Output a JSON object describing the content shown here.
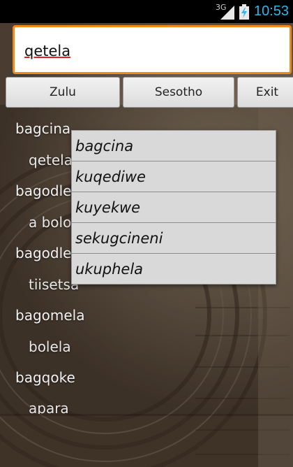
{
  "status_bar": {
    "network": "3G",
    "time": "10:53",
    "accent_color": "#33b5e5"
  },
  "search": {
    "value": "qetela"
  },
  "buttons": {
    "zulu": "Zulu",
    "sesotho": "Sesotho",
    "exit": "Exit"
  },
  "word_list": [
    "bagcina",
    "qetela",
    "bagodle",
    "a bolo",
    "bagodle",
    "tiisetsa",
    "bagomela",
    "bolela",
    "bagqoke",
    "apara"
  ],
  "suggestions": [
    "bagcina",
    "kuqediwe",
    "kuyekwe",
    "sekugcineni",
    "ukuphela"
  ],
  "colors": {
    "search_border": "#f08a1c",
    "spell_underline": "#e02020"
  }
}
